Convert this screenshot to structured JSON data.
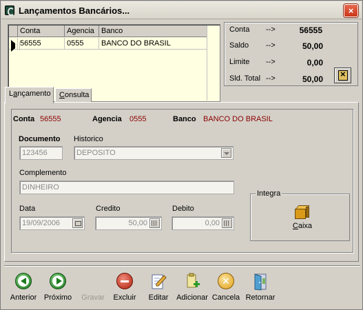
{
  "window": {
    "title": "Lançamentos Bancários...",
    "close_glyph": "×"
  },
  "grid": {
    "columns": [
      "Conta",
      "Agencia",
      "Banco"
    ],
    "rows": [
      {
        "conta": "56555",
        "agencia": "0555",
        "banco": "BANCO DO BRASIL"
      }
    ]
  },
  "summary": {
    "conta_label": "Conta",
    "conta_arrow": "-->",
    "conta_value": "56555",
    "saldo_label": "Saldo",
    "saldo_arrow": "-->",
    "saldo_value": "50,00",
    "limite_label": "Limite",
    "limite_arrow": "-->",
    "limite_value": "0,00",
    "sld_total_label": "Sld. Total",
    "sld_total_arrow": "-->",
    "sld_total_value": "50,00"
  },
  "tabs": {
    "lancamento_prefix": "L",
    "lancamento_u": "a",
    "lancamento_rest": "nçamento",
    "consulta_prefix": "",
    "consulta_u": "C",
    "consulta_rest": "onsulta"
  },
  "header": {
    "conta_label": "Conta",
    "conta_value": "56555",
    "agencia_label": "Agencia",
    "agencia_value": "0555",
    "banco_label": "Banco",
    "banco_value": "BANCO DO BRASIL"
  },
  "form": {
    "documento_label": "Documento",
    "documento_value": "123456",
    "historico_label": "Historico",
    "historico_value": "DEPOSITO",
    "complemento_label": "Complemento",
    "complemento_value": "DINHEIRO",
    "data_label": "Data",
    "data_value": "19/09/2006",
    "credito_label": "Credito",
    "credito_value": "50,00",
    "debito_label": "Debito",
    "debito_value": "0,00"
  },
  "integra": {
    "legend": "Integra",
    "caixa_u": "C",
    "caixa_rest": "aixa"
  },
  "toolbar": {
    "anterior": "Anterior",
    "proximo": "Próximo",
    "gravar": "Gravar",
    "excluir": "Excluir",
    "editar": "Editar",
    "adicionar": "Adicionar",
    "cancela": "Cancela",
    "retornar": "Retornar"
  },
  "colors": {
    "accent_value": "#8b0000",
    "grid_background": "#ffffe1",
    "window_face": "#d4d0c8"
  }
}
